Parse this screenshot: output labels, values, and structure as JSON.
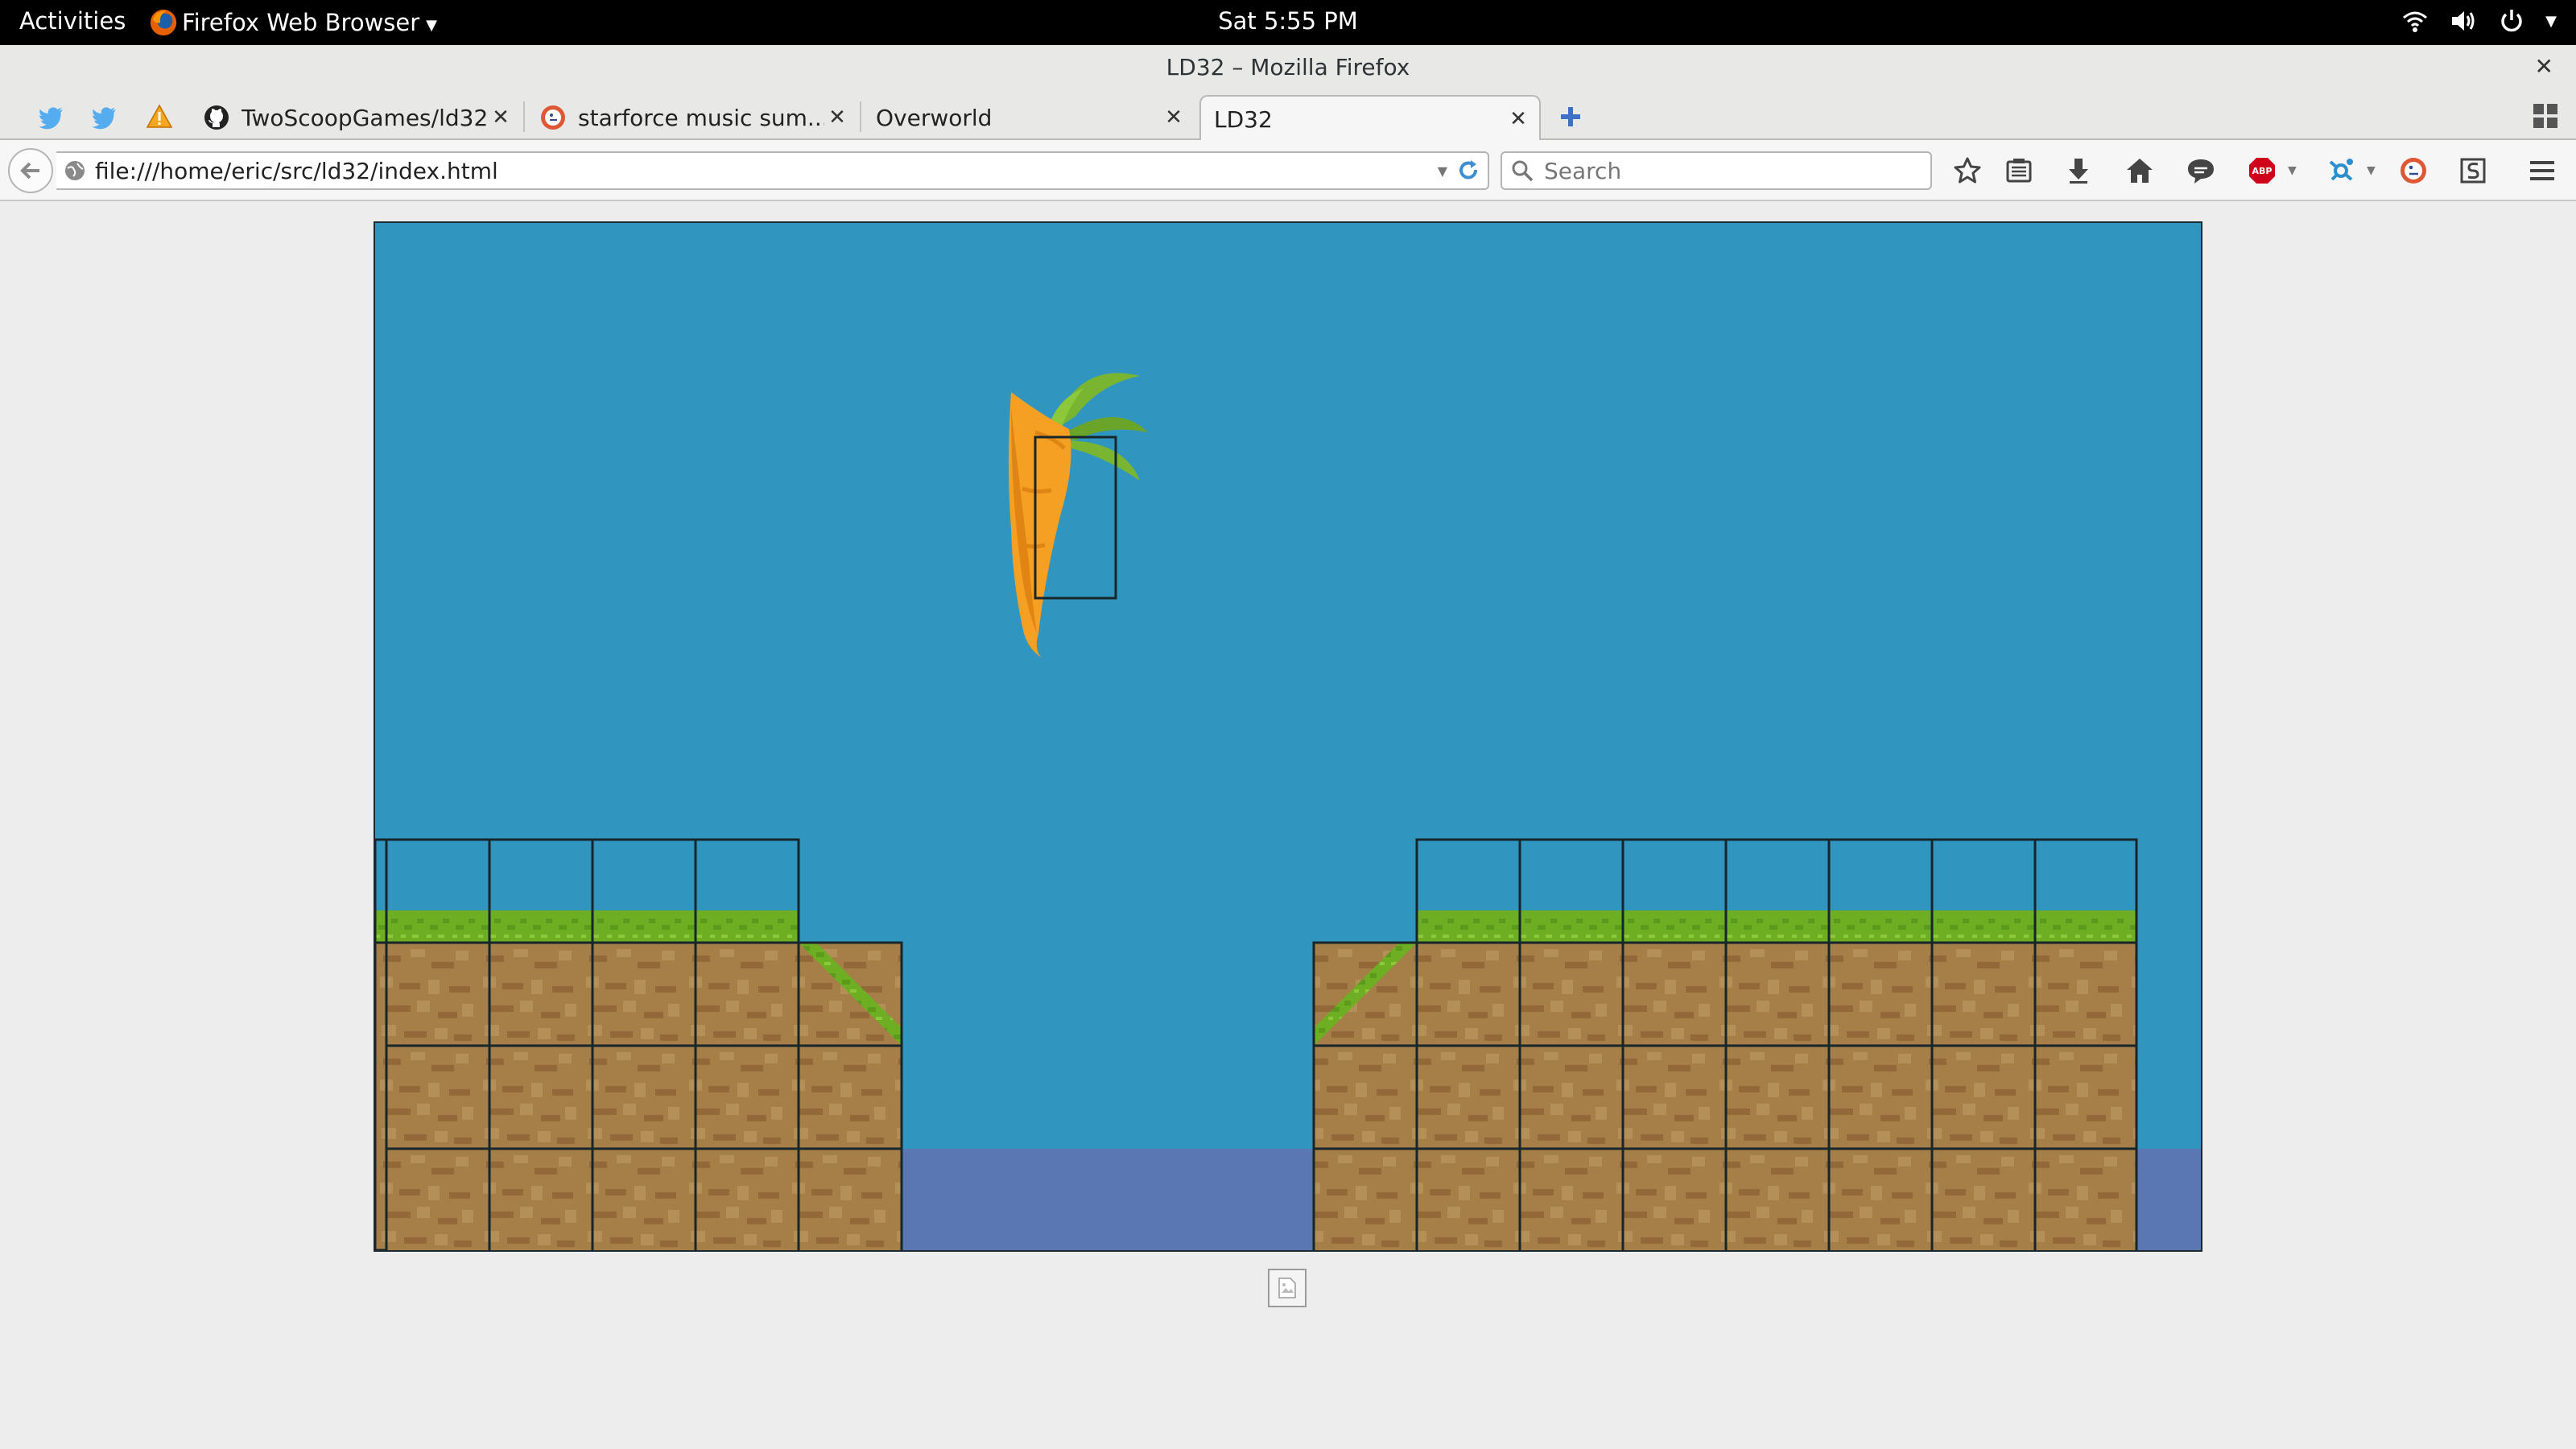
{
  "topbar": {
    "activities": "Activities",
    "app_menu": "Firefox Web Browser",
    "clock": "Sat  5:55 PM",
    "icons": [
      "wifi-icon",
      "volume-icon",
      "power-icon"
    ]
  },
  "window": {
    "title": "LD32 – Mozilla Firefox"
  },
  "tabs": {
    "pinned": [
      {
        "icon": "twitter-icon"
      },
      {
        "icon": "twitter-icon"
      },
      {
        "icon": "warning-icon"
      }
    ],
    "items": [
      {
        "label": "TwoScoopGames/ld32",
        "icon": "github-icon",
        "active": false
      },
      {
        "label": "starforce music sum...",
        "icon": "duckduckgo-icon",
        "active": false
      },
      {
        "label": "Overworld",
        "icon": "",
        "active": false
      },
      {
        "label": "LD32",
        "icon": "",
        "active": true
      }
    ]
  },
  "navbar": {
    "url": "file:///home/eric/src/ld32/index.html",
    "search_placeholder": "Search",
    "toolbar_icons": [
      "bookmark-star-icon",
      "reading-list-icon",
      "download-icon",
      "home-icon",
      "chat-icon",
      "adblock-icon",
      "addon-icon",
      "duckduckgo-icon",
      "screenshot-icon",
      "menu-icon"
    ],
    "adblock_label": "ABP"
  },
  "colors": {
    "sky": "#3096bf",
    "water": "#5a77b3",
    "dirt": "#a57e48",
    "grass": "#6eae23",
    "carrot": "#f5a023",
    "leaves": "#7ab532",
    "tile_outline": "#16262b"
  },
  "game": {
    "sprite": "carrot-player",
    "tiles": {
      "left_platform": {
        "columns": 5,
        "rows_dirt": 3,
        "rows_grass": 1,
        "slope": "down-right"
      },
      "right_platform": {
        "columns": 7,
        "rows_dirt": 3,
        "rows_grass": 1,
        "slope": "up-right"
      }
    }
  }
}
